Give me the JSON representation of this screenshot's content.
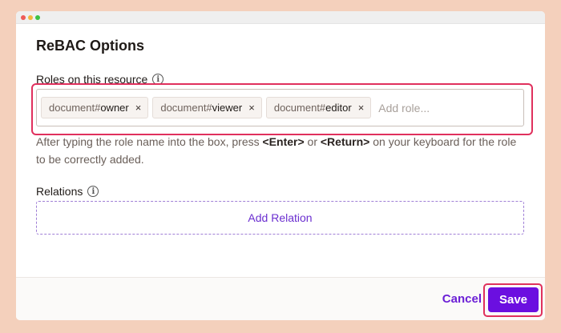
{
  "dialog": {
    "title": "ReBAC Options",
    "roles_label": "Roles on this resource",
    "roles": [
      {
        "prefix": "document#",
        "role": "owner"
      },
      {
        "prefix": "document#",
        "role": "viewer"
      },
      {
        "prefix": "document#",
        "role": "editor"
      }
    ],
    "remove_glyph": "×",
    "add_role_placeholder": "Add role...",
    "help": {
      "part1": "After typing the role name into the box, press ",
      "key1": "<Enter>",
      "part2": " or ",
      "key2": "<Return>",
      "part3": " on your keyboard for the role to be correctly added."
    },
    "relations_label": "Relations",
    "add_relation_label": "Add Relation",
    "info_glyph": "i"
  },
  "footer": {
    "cancel_label": "Cancel",
    "save_label": "Save"
  },
  "colors": {
    "accent": "#6b0fe0",
    "highlight": "#e0305d",
    "background": "#f4d0bc"
  }
}
